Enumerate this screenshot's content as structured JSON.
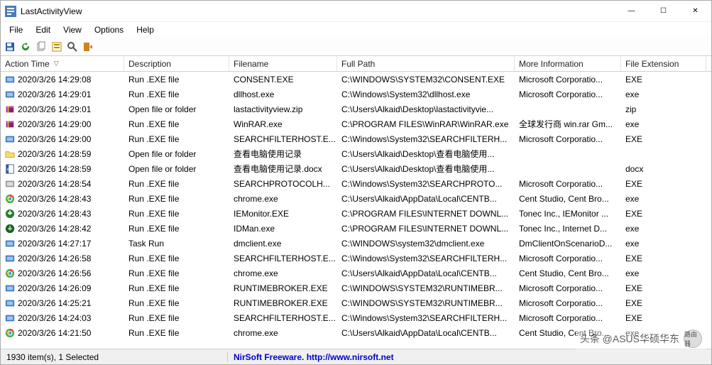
{
  "window": {
    "title": "LastActivityView"
  },
  "menus": {
    "file": "File",
    "edit": "Edit",
    "view": "View",
    "options": "Options",
    "help": "Help"
  },
  "toolbar_icons": [
    "save",
    "refresh",
    "copy",
    "props",
    "find",
    "exit"
  ],
  "columns": {
    "time": "Action Time",
    "desc": "Description",
    "file": "Filename",
    "path": "Full Path",
    "more": "More Information",
    "ext": "File Extension"
  },
  "rows": [
    {
      "icon": "exe-blue",
      "time": "2020/3/26 14:29:08",
      "desc": "Run .EXE file",
      "file": "CONSENT.EXE",
      "path": "C:\\WINDOWS\\SYSTEM32\\CONSENT.EXE",
      "more": "Microsoft Corporatio...",
      "ext": "EXE"
    },
    {
      "icon": "exe-blue",
      "time": "2020/3/26 14:29:01",
      "desc": "Run .EXE file",
      "file": "dllhost.exe",
      "path": "C:\\Windows\\System32\\dllhost.exe",
      "more": "Microsoft Corporatio...",
      "ext": "exe"
    },
    {
      "icon": "winrar",
      "time": "2020/3/26 14:29:01",
      "desc": "Open file or folder",
      "file": "lastactivityview.zip",
      "path": "C:\\Users\\Alkaid\\Desktop\\lastactivityvie...",
      "more": "",
      "ext": "zip"
    },
    {
      "icon": "winrar",
      "time": "2020/3/26 14:29:00",
      "desc": "Run .EXE file",
      "file": "WinRAR.exe",
      "path": "C:\\PROGRAM FILES\\WinRAR\\WinRAR.exe",
      "more": "全球发行商 win.rar Gm...",
      "ext": "exe"
    },
    {
      "icon": "exe-blue",
      "time": "2020/3/26 14:29:00",
      "desc": "Run .EXE file",
      "file": "SEARCHFILTERHOST.E...",
      "path": "C:\\Windows\\System32\\SEARCHFILTERH...",
      "more": "Microsoft Corporatio...",
      "ext": "EXE"
    },
    {
      "icon": "folder",
      "time": "2020/3/26 14:28:59",
      "desc": "Open file or folder",
      "file": "查看电脑使用记录",
      "path": "C:\\Users\\Alkaid\\Desktop\\查看电脑使用...",
      "more": "",
      "ext": ""
    },
    {
      "icon": "docx",
      "time": "2020/3/26 14:28:59",
      "desc": "Open file or folder",
      "file": "查看电脑使用记录.docx",
      "path": "C:\\Users\\Alkaid\\Desktop\\查看电脑使用...",
      "more": "",
      "ext": "docx"
    },
    {
      "icon": "exe-grey",
      "time": "2020/3/26 14:28:54",
      "desc": "Run .EXE file",
      "file": "SEARCHPROTOCOLH...",
      "path": "C:\\Windows\\System32\\SEARCHPROTO...",
      "more": "Microsoft Corporatio...",
      "ext": "EXE"
    },
    {
      "icon": "chrome",
      "time": "2020/3/26 14:28:43",
      "desc": "Run .EXE file",
      "file": "chrome.exe",
      "path": "C:\\Users\\Alkaid\\AppData\\Local\\CENTB...",
      "more": "Cent Studio, Cent Bro...",
      "ext": "exe"
    },
    {
      "icon": "idm",
      "time": "2020/3/26 14:28:43",
      "desc": "Run .EXE file",
      "file": "IEMonitor.EXE",
      "path": "C:\\PROGRAM FILES\\INTERNET DOWNL...",
      "more": "Tonec Inc., IEMonitor ...",
      "ext": "EXE"
    },
    {
      "icon": "idm-green",
      "time": "2020/3/26 14:28:42",
      "desc": "Run .EXE file",
      "file": "IDMan.exe",
      "path": "C:\\PROGRAM FILES\\INTERNET DOWNL...",
      "more": "Tonec Inc., Internet D...",
      "ext": "exe"
    },
    {
      "icon": "exe-blue",
      "time": "2020/3/26 14:27:17",
      "desc": "Task Run",
      "file": "dmclient.exe",
      "path": "C:\\WINDOWS\\system32\\dmclient.exe",
      "more": "DmClientOnScenarioD...",
      "ext": "exe"
    },
    {
      "icon": "exe-blue",
      "time": "2020/3/26 14:26:58",
      "desc": "Run .EXE file",
      "file": "SEARCHFILTERHOST.E...",
      "path": "C:\\Windows\\System32\\SEARCHFILTERH...",
      "more": "Microsoft Corporatio...",
      "ext": "EXE"
    },
    {
      "icon": "chrome",
      "time": "2020/3/26 14:26:56",
      "desc": "Run .EXE file",
      "file": "chrome.exe",
      "path": "C:\\Users\\Alkaid\\AppData\\Local\\CENTB...",
      "more": "Cent Studio, Cent Bro...",
      "ext": "exe"
    },
    {
      "icon": "exe-blue",
      "time": "2020/3/26 14:26:09",
      "desc": "Run .EXE file",
      "file": "RUNTIMEBROKER.EXE",
      "path": "C:\\WINDOWS\\SYSTEM32\\RUNTIMEBR...",
      "more": "Microsoft Corporatio...",
      "ext": "EXE"
    },
    {
      "icon": "exe-blue",
      "time": "2020/3/26 14:25:21",
      "desc": "Run .EXE file",
      "file": "RUNTIMEBROKER.EXE",
      "path": "C:\\WINDOWS\\SYSTEM32\\RUNTIMEBR...",
      "more": "Microsoft Corporatio...",
      "ext": "EXE"
    },
    {
      "icon": "exe-blue",
      "time": "2020/3/26 14:24:03",
      "desc": "Run .EXE file",
      "file": "SEARCHFILTERHOST.E...",
      "path": "C:\\Windows\\System32\\SEARCHFILTERH...",
      "more": "Microsoft Corporatio...",
      "ext": "EXE"
    },
    {
      "icon": "chrome",
      "time": "2020/3/26 14:21:50",
      "desc": "Run .EXE file",
      "file": "chrome.exe",
      "path": "C:\\Users\\Alkaid\\AppData\\Local\\CENTB...",
      "more": "Cent Studio, Cent Bro...",
      "ext": "exe"
    }
  ],
  "status": {
    "left": "1930 item(s), 1 Selected",
    "link": "NirSoft Freeware.  http://www.nirsoft.net"
  },
  "watermark": {
    "text": "头条 @ASUS华硕华东",
    "badge": "路由器"
  }
}
